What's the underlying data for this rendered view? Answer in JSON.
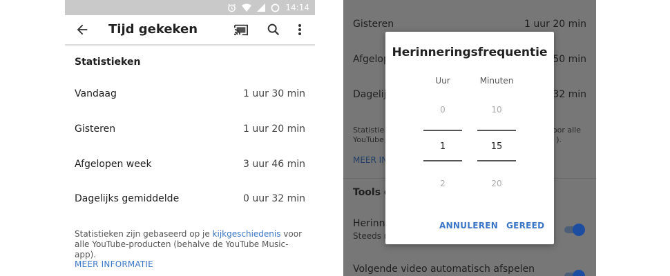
{
  "left": {
    "status_time": "14:14",
    "title": "Tijd gekeken",
    "section": "Statistieken",
    "rows": [
      {
        "label": "Vandaag",
        "value": "1 uur 30 min"
      },
      {
        "label": "Gisteren",
        "value": "1 uur 20 min"
      },
      {
        "label": "Afgelopen week",
        "value": "3 uur 46 min"
      },
      {
        "label": "Dagelijks gemiddelde",
        "value": "0 uur 32 min"
      }
    ],
    "note_before": "Statistieken zijn gebaseerd op je ",
    "note_link": "kijkgeschiedenis",
    "note_after": " voor alle YouTube-producten (behalve de YouTube Music-app).",
    "more_info": "MEER INFORMATIE"
  },
  "right": {
    "bg": {
      "gisteren": "Gisteren",
      "gisteren_val": "1 uur 20 min",
      "afgelop": "Afgelop",
      "afgelop_val": "50 min",
      "dagelij": "Dagelij",
      "dagelij_val": "32 min",
      "stat_left_1": "Statistie",
      "stat_left_2": "YouTube",
      "stat_right_1": "oor alle",
      "stat_right_2": ").",
      "meer": "MEER IN",
      "tools": "Tools o",
      "herinn": "Herinne",
      "steeds": "Steeds n",
      "volgende": "Volgende video automatisch afspelen"
    },
    "dialog": {
      "title": "Herinneringsfrequentie",
      "col_hour": "Uur",
      "col_min": "Minuten",
      "hour_prev": "0",
      "hour_sel": "1",
      "hour_next": "2",
      "min_prev": "10",
      "min_sel": "15",
      "min_next": "20",
      "cancel": "ANNULEREN",
      "done": "GEREED"
    }
  },
  "colors": {
    "accent": "#3a76c7",
    "toggle": "#1d4da0",
    "scrim": "#777777"
  },
  "icons": [
    "back-arrow-icon",
    "cast-icon",
    "search-icon",
    "more-vert-icon",
    "alarm-icon",
    "wifi-icon",
    "signal-icon",
    "battery-icon"
  ]
}
